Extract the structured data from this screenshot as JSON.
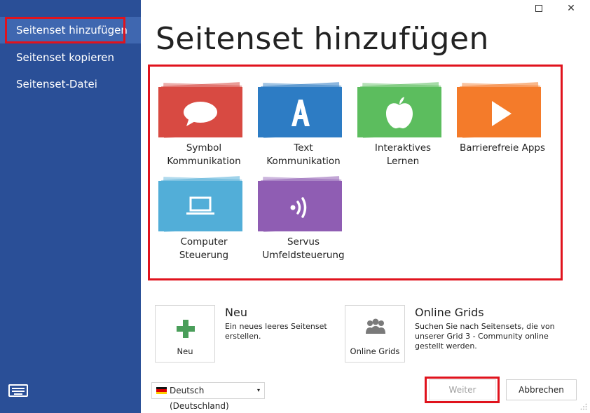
{
  "sidebar": {
    "items": [
      {
        "label": "Seitenset hinzufügen"
      },
      {
        "label": "Seitenset kopieren"
      },
      {
        "label": "Seitenset-Datei"
      }
    ]
  },
  "window": {
    "maximize": "",
    "close": "✕"
  },
  "title": "Seitenset hinzufügen",
  "tiles": [
    {
      "label": "Symbol\nKommunikation",
      "color": "#d84a42",
      "icon": "speech-bubble-icon"
    },
    {
      "label": "Text\nKommunikation",
      "color": "#2d7cc4",
      "icon": "letter-a-icon",
      "glyph": "A"
    },
    {
      "label": "Interaktives Lernen",
      "color": "#5cbd5e",
      "icon": "apple-icon"
    },
    {
      "label": "Barrierefreie Apps",
      "color": "#f47b2a",
      "icon": "play-icon"
    },
    {
      "label": "Computer\nSteuerung",
      "color": "#52aed8",
      "icon": "laptop-icon"
    },
    {
      "label": "Servus\nUmfeldsteuerung",
      "color": "#8f5db3",
      "icon": "signal-icon"
    }
  ],
  "options": {
    "neu": {
      "button_label": "Neu",
      "title": "Neu",
      "description": "Ein neues leeres Seitenset erstellen.",
      "icon": "plus-icon",
      "color": "#4a9e5a"
    },
    "online": {
      "button_label": "Online Grids",
      "title": "Online Grids",
      "description": "Suchen Sie nach Seitensets, die von unserer Grid 3 - Community online gestellt werden.",
      "icon": "people-icon",
      "color": "#7a7a7a"
    }
  },
  "language": {
    "selected": "Deutsch (Deutschland)",
    "caret": "▾"
  },
  "footer": {
    "next_label": "Weiter",
    "cancel_label": "Abbrechen"
  },
  "colors": {
    "sidebar": "#2a4f97",
    "sidebar_active": "#3f67b0",
    "highlight": "#e0131d"
  }
}
